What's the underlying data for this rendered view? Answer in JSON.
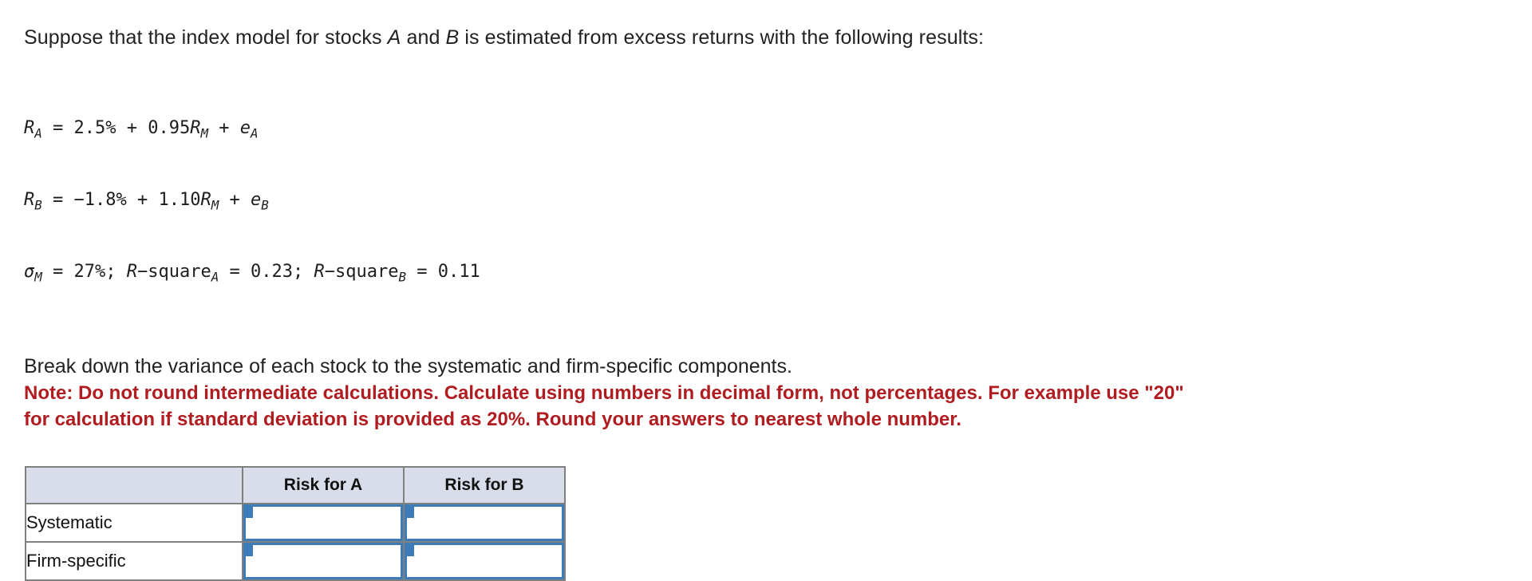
{
  "problem": {
    "intro": {
      "part1": "Suppose that the index model for stocks ",
      "var_a": "A",
      "part2": " and ",
      "var_b": "B",
      "part3": " is estimated from excess returns with the following results:"
    },
    "equations": [
      {
        "id": "equation-ra",
        "segments": [
          {
            "text": "R",
            "style": "italic"
          },
          {
            "text": "A",
            "style": "sub"
          },
          {
            "text": " = 2.5% + 0.95",
            "style": "plain"
          },
          {
            "text": "R",
            "style": "italic"
          },
          {
            "text": "M",
            "style": "sub"
          },
          {
            "text": " + ",
            "style": "plain"
          },
          {
            "text": "e",
            "style": "italic"
          },
          {
            "text": "A",
            "style": "sub"
          }
        ],
        "plain": "RA = 2.5% + 0.95RM + eA"
      },
      {
        "id": "equation-rb",
        "segments": [
          {
            "text": "R",
            "style": "italic"
          },
          {
            "text": "B",
            "style": "sub"
          },
          {
            "text": " = −1.8% + 1.10",
            "style": "plain"
          },
          {
            "text": "R",
            "style": "italic"
          },
          {
            "text": "M",
            "style": "sub"
          },
          {
            "text": " + ",
            "style": "plain"
          },
          {
            "text": "e",
            "style": "italic"
          },
          {
            "text": "B",
            "style": "sub"
          }
        ],
        "plain": "RB = −1.8% + 1.10RM + eB"
      },
      {
        "id": "equation-sigma",
        "segments": [
          {
            "text": "σ",
            "style": "italic"
          },
          {
            "text": "M",
            "style": "sub"
          },
          {
            "text": " = 27%; ",
            "style": "plain"
          },
          {
            "text": "R",
            "style": "italic"
          },
          {
            "text": "−square",
            "style": "plain"
          },
          {
            "text": "A",
            "style": "sub"
          },
          {
            "text": " = 0.23; ",
            "style": "plain"
          },
          {
            "text": "R",
            "style": "italic"
          },
          {
            "text": "−square",
            "style": "plain"
          },
          {
            "text": "B",
            "style": "sub"
          },
          {
            "text": " = 0.11",
            "style": "plain"
          }
        ],
        "plain": "σM = 27%; R−squareA = 0.23; R−squareB = 0.11"
      }
    ],
    "instruction": "Break down the variance of each stock to the systematic and firm-specific components.",
    "note_lines": [
      "Note: Do not round intermediate calculations. Calculate using numbers in decimal form, not percentages. For example use \"20\"",
      "for calculation if standard deviation is provided as 20%. Round your answers to nearest whole number."
    ],
    "note_color": "#b01c20"
  },
  "answer_table": {
    "headers": [
      "",
      "Risk for A",
      "Risk for B"
    ],
    "rows": [
      {
        "label": "Systematic",
        "cells": [
          {
            "name": "systematic-risk-a-input",
            "value": "",
            "placeholder": ""
          },
          {
            "name": "systematic-risk-b-input",
            "value": "",
            "placeholder": ""
          }
        ]
      },
      {
        "label": "Firm-specific",
        "cells": [
          {
            "name": "firm-specific-risk-a-input",
            "value": "",
            "placeholder": ""
          },
          {
            "name": "firm-specific-risk-b-input",
            "value": "",
            "placeholder": ""
          }
        ]
      }
    ],
    "header_bg": "#d8dde9",
    "border_color": "#808080",
    "input_border_color": "#3d7cb8"
  }
}
